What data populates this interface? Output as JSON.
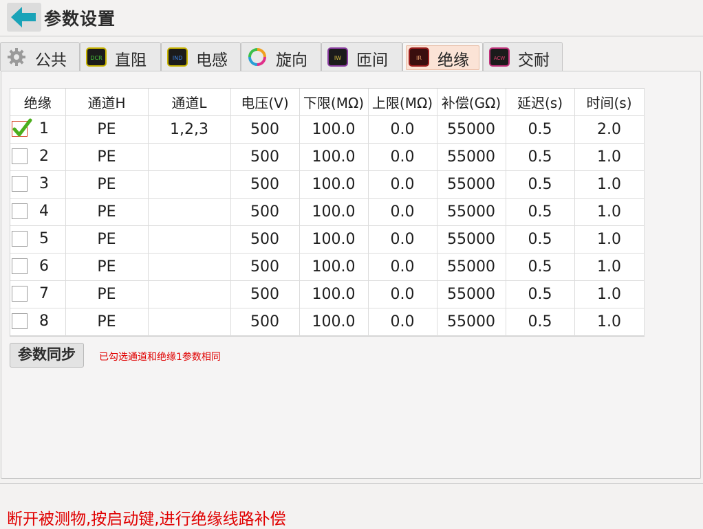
{
  "header": {
    "title": "参数设置",
    "back_icon": "back-arrow-icon"
  },
  "tabs": [
    {
      "label": "公共",
      "icon": "gear-icon",
      "active": false
    },
    {
      "label": "直阻",
      "icon": "dcr-icon",
      "icon_text": "DCR",
      "active": false
    },
    {
      "label": "电感",
      "icon": "ind-icon",
      "icon_text": "IND",
      "active": false
    },
    {
      "label": "旋向",
      "icon": "rotation-icon",
      "active": false
    },
    {
      "label": "匝间",
      "icon": "iw-icon",
      "icon_text": "IW",
      "active": false
    },
    {
      "label": "绝缘",
      "icon": "ir-icon",
      "icon_text": "IR",
      "active": true
    },
    {
      "label": "交耐",
      "icon": "acw-icon",
      "icon_text": "ACW",
      "active": false
    }
  ],
  "table": {
    "columns": [
      "绝缘",
      "通道H",
      "通道L",
      "电压(V)",
      "下限(MΩ)",
      "上限(MΩ)",
      "补偿(GΩ)",
      "延迟(s)",
      "时间(s)"
    ],
    "rows": [
      {
        "checked": true,
        "cells": [
          "1",
          "PE",
          "1,2,3",
          "500",
          "100.0",
          "0.0",
          "55000",
          "0.5",
          "2.0"
        ]
      },
      {
        "checked": false,
        "cells": [
          "2",
          "PE",
          "",
          "500",
          "100.0",
          "0.0",
          "55000",
          "0.5",
          "1.0"
        ]
      },
      {
        "checked": false,
        "cells": [
          "3",
          "PE",
          "",
          "500",
          "100.0",
          "0.0",
          "55000",
          "0.5",
          "1.0"
        ]
      },
      {
        "checked": false,
        "cells": [
          "4",
          "PE",
          "",
          "500",
          "100.0",
          "0.0",
          "55000",
          "0.5",
          "1.0"
        ]
      },
      {
        "checked": false,
        "cells": [
          "5",
          "PE",
          "",
          "500",
          "100.0",
          "0.0",
          "55000",
          "0.5",
          "1.0"
        ]
      },
      {
        "checked": false,
        "cells": [
          "6",
          "PE",
          "",
          "500",
          "100.0",
          "0.0",
          "55000",
          "0.5",
          "1.0"
        ]
      },
      {
        "checked": false,
        "cells": [
          "7",
          "PE",
          "",
          "500",
          "100.0",
          "0.0",
          "55000",
          "0.5",
          "1.0"
        ]
      },
      {
        "checked": false,
        "cells": [
          "8",
          "PE",
          "",
          "500",
          "100.0",
          "0.0",
          "55000",
          "0.5",
          "1.0"
        ]
      }
    ]
  },
  "sync": {
    "button_label": "参数同步",
    "note": "已勾选通道和绝缘1参数相同"
  },
  "status": {
    "message": "断开被测物,按启动键,进行绝缘线路补偿"
  },
  "colors": {
    "accent": "#1aa3b8",
    "alert": "#e00000",
    "active_tab": "#fbe3d6",
    "check": "#4cae1d"
  }
}
